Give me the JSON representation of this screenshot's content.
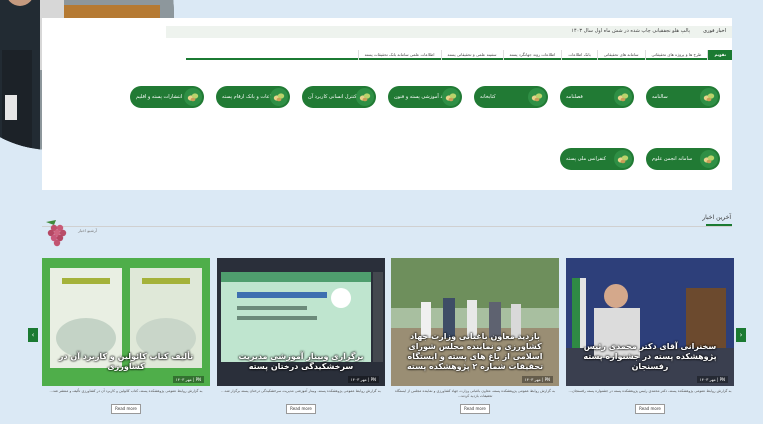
{
  "ticker": {
    "label": "اخبار فوری",
    "text": "پالپ هلو نجفقیانی چاپ شده در شش ماه اول سال ۱۴۰۳"
  },
  "tabs": [
    {
      "label": "تقویم",
      "active": true
    },
    {
      "label": "طرح ها و پروژه های تحقیقاتی",
      "active": false
    },
    {
      "label": "سامانه های تحقیقاتی",
      "active": false
    },
    {
      "label": "بانک اطلاعات",
      "active": false
    },
    {
      "label": "اطلاعات روند جهانگرد پسته",
      "active": false
    },
    {
      "label": "سفینه علمی و تحقیقاتی پسته",
      "active": false
    },
    {
      "label": "اطلاعات علمی سامانه بانک تحقیقات پسته",
      "active": false
    }
  ],
  "quicklinks": {
    "row1": [
      "سالنامه",
      "فصلنامه",
      "کتابخانه",
      "بازدید آموزشی پسته و فنون",
      "کنترل انسانی کاربرد آن",
      "اطلاعات و بانک ارقام پسته",
      "انتشارات پسته و اقلیم"
    ],
    "row2": [
      "سامانه انجمن علوم",
      "کنفرانس ملی پسته"
    ]
  },
  "news": {
    "title": "آخرین اخبار",
    "archive_label": "آرشیو اخبار",
    "read_more": "Read more",
    "cards": [
      {
        "caption": "سخنرانی آقای دکتر محمدی رئیس پژوهشکده پسته در جشنواره پسته رفسنجان",
        "meta": "PN | مهر ۱۴۰۳",
        "snippet": "به گزارش روابط عمومی پژوهشکده پسته، دکتر محمدی رئیس پژوهشکده پسته در جشنواره پسته رفسنجان..."
      },
      {
        "caption": "بازدید معاون باغبانی وزارت جهاد کشاورزی و نماینده مجلس شورای اسلامی از باغ های پسته و ایستگاه تحقیقات شماره ۲ پژوهشکده پسته",
        "meta": "PN | مهر ۱۴۰۳",
        "snippet": "به گزارش روابط عمومی پژوهشکده پسته، معاون باغبانی وزارت جهاد کشاورزی و نماینده مجلس از ایستگاه تحقیقات بازدید کردند..."
      },
      {
        "caption": "برگزاری وبینار آموزشی مدیریت سرخشکیدگی درختان پسته",
        "meta": "PN | مهر ۱۴۰۳",
        "snippet": "به گزارش روابط عمومی پژوهشکده پسته، وبینار آموزشی مدیریت سرخشکیدگی درختان پسته برگزار شد..."
      },
      {
        "caption": "تألیف کتاب کائولین و کاربرد آن در کشاورزی",
        "meta": "PN | مهر ۱۴۰۳",
        "snippet": "به گزارش روابط عمومی پژوهشکده پسته، کتاب کائولین و کاربرد آن در کشاورزی تألیف و منتشر شد..."
      }
    ]
  },
  "colors": {
    "brand_green": "#1b7a32",
    "pill_green": "#217a34"
  }
}
